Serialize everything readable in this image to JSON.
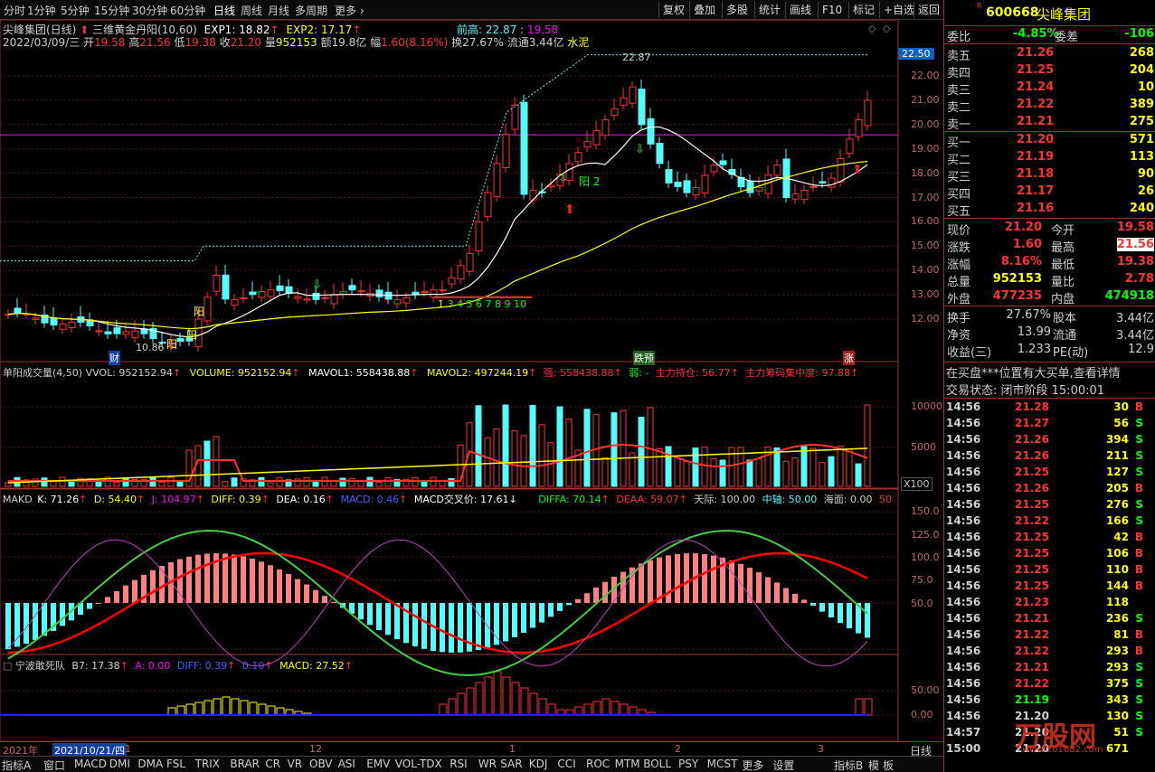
{
  "toolbar": {
    "timeframes": [
      "分时",
      "1分钟",
      "5分钟",
      "15分钟",
      "30分钟",
      "60分钟",
      "日线",
      "周线",
      "月线",
      "多周期",
      "更多"
    ],
    "active": "日线",
    "right_buttons": [
      "复权",
      "叠加",
      "多股",
      "统计",
      "画线",
      "F10",
      "标记",
      "+自选",
      "返回"
    ]
  },
  "main_chart": {
    "stock_title": "尖峰集团(日线)",
    "indicator_name": "三维黄金丹阳(10,60)",
    "exp1": "EXP1: 18.82",
    "exp2": "EXP2: 17.17",
    "prev_high_label": "前高: 22.87",
    "prev_high_value2": "19.58",
    "info_line": {
      "date": "2022/03/09/三",
      "open_label": "开",
      "open": "19.58",
      "high_label": "高",
      "high": "21.56",
      "low_label": "低",
      "low": "19.38",
      "close_label": "收",
      "close": "21.20",
      "vol_label": "量",
      "vol": "952153",
      "amount_label": "额",
      "amount": "19.8亿",
      "range_label": "幅",
      "range": "1.60(8.16%)",
      "turnover": "换27.67%",
      "float": "流通3.44亿",
      "industry": "水泥"
    },
    "price_ticks": [
      "22.00",
      "21.00",
      "20.00",
      "19.00",
      "18.00",
      "17.00",
      "16.00",
      "15.00",
      "14.00",
      "13.00",
      "12.00"
    ],
    "current_price_tag": "22.50",
    "annotations": {
      "high": "22.87",
      "low": "10.86",
      "yang1": "阳",
      "yang2": "阳",
      "yang3": "阳",
      "yang_label": "阳 2",
      "seq": "3 4 5 6 7 8 9 10",
      "cai": "财",
      "diyu": "跌预",
      "zhang": "涨"
    }
  },
  "volume_panel": {
    "title": "单阳成交量(4,50)",
    "vvol": "VVOL: 952152.94",
    "volume": "VOLUME: 952152.94",
    "mavol1": "MAVOL1: 558438.88",
    "mavol2": "MAVOL2: 497244.19",
    "qiang": "强: 558438.88",
    "ruo": "弱: -",
    "zlcc": "主力持仓: 56.77",
    "zlcm": "主力筹码集中度: 97.88",
    "ticks": [
      "10000",
      "5000"
    ],
    "unit": "X100"
  },
  "makd_panel": {
    "title": "MAKD",
    "k": "K: 71.26",
    "d": "D: 54.40",
    "j": "J: 104.97",
    "diff": "DIFF: 0.39",
    "dea": "DEA: 0.16",
    "macd": "MACD: 0.46",
    "cross": "MACD交叉价: 17.61",
    "diffa": "DIFFA: 70.14",
    "deaa": "DEAA: 59.07",
    "tianji": "天际: 100.00",
    "zhongzhou": "中轴: 50.00",
    "haimian": "海面: 0.00",
    "last": "50",
    "ticks": [
      "150.0",
      "125.0",
      "100.0",
      "75.0",
      "50.0"
    ]
  },
  "nb_panel": {
    "title": "宁波敢死队",
    "b7": "B7: 17.38",
    "a": "A: 0.00",
    "diff": "DIFF: 0.39",
    "v": "0.10",
    "macd": "MACD: 27.52",
    "ticks": [
      "50.00",
      "0.00"
    ]
  },
  "x_axis": {
    "year": "2021年",
    "date": "2021/10/21/四",
    "labels": [
      "1",
      "12",
      "1",
      "2",
      "3"
    ],
    "period": "日线"
  },
  "bottom_tabs": [
    "指标A",
    "窗口",
    "MACD",
    "DMI",
    "DMA",
    "FSL",
    "TRIX",
    "BRAR",
    "CR",
    "VR",
    "OBV",
    "ASI",
    "EMV",
    "VOL-TDX",
    "RSI",
    "WR",
    "SAR",
    "KDJ",
    "CCI",
    "ROC",
    "MTM",
    "BOLL",
    "PSY",
    "MCST",
    "更多",
    "设置"
  ],
  "bottom_right": [
    "指标B",
    "模",
    "板"
  ],
  "side": {
    "code": "600668",
    "name": "尖峰集团",
    "weibi_label": "委比",
    "weibi": "-4.85%",
    "weicha_label": "委差",
    "weicha": "-106",
    "asks": [
      {
        "l": "卖五",
        "p": "21.26",
        "v": "268"
      },
      {
        "l": "卖四",
        "p": "21.25",
        "v": "204"
      },
      {
        "l": "卖三",
        "p": "21.24",
        "v": "10"
      },
      {
        "l": "卖二",
        "p": "21.22",
        "v": "389"
      },
      {
        "l": "卖一",
        "p": "21.21",
        "v": "275"
      }
    ],
    "bids": [
      {
        "l": "买一",
        "p": "21.20",
        "v": "571"
      },
      {
        "l": "买二",
        "p": "21.19",
        "v": "113"
      },
      {
        "l": "买三",
        "p": "21.18",
        "v": "90"
      },
      {
        "l": "买四",
        "p": "21.17",
        "v": "26"
      },
      {
        "l": "买五",
        "p": "21.16",
        "v": "240"
      }
    ],
    "quote": [
      {
        "l1": "现价",
        "v1": "21.20",
        "l2": "今开",
        "v2": "19.58"
      },
      {
        "l1": "涨跌",
        "v1": "1.60",
        "l2": "最高",
        "v2": "21.56"
      },
      {
        "l1": "涨幅",
        "v1": "8.16%",
        "l2": "最低",
        "v2": "19.38"
      },
      {
        "l1": "总量",
        "v1": "952153",
        "l2": "量比",
        "v2": "2.78"
      },
      {
        "l1": "外盘",
        "v1": "477235",
        "l2": "内盘",
        "v2": "474918"
      }
    ],
    "stats": [
      {
        "l1": "换手",
        "v1": "27.67%",
        "l2": "股本",
        "v2": "3.44亿"
      },
      {
        "l1": "净资",
        "v1": "13.99",
        "l2": "流通",
        "v2": "3.44亿"
      },
      {
        "l1": "收益(三)",
        "v1": "1.233",
        "l2": "PE(动)",
        "v2": "12.9"
      }
    ],
    "msg": "在买盘***位置有大买单,查看详情",
    "status": "交易状态: 闭市阶段 15:00:01",
    "ticks": [
      {
        "t": "14:56",
        "p": "21.28",
        "v": "30",
        "s": "B"
      },
      {
        "t": "14:56",
        "p": "21.27",
        "v": "56",
        "s": "S"
      },
      {
        "t": "14:56",
        "p": "21.26",
        "v": "394",
        "s": "S"
      },
      {
        "t": "14:56",
        "p": "21.26",
        "v": "211",
        "s": "S"
      },
      {
        "t": "14:56",
        "p": "21.25",
        "v": "127",
        "s": "S"
      },
      {
        "t": "14:56",
        "p": "21.26",
        "v": "205",
        "s": "B"
      },
      {
        "t": "14:56",
        "p": "21.25",
        "v": "276",
        "s": "S"
      },
      {
        "t": "14:56",
        "p": "21.22",
        "v": "166",
        "s": "S"
      },
      {
        "t": "14:56",
        "p": "21.25",
        "v": "42",
        "s": "B"
      },
      {
        "t": "14:56",
        "p": "21.25",
        "v": "106",
        "s": "B"
      },
      {
        "t": "14:56",
        "p": "21.25",
        "v": "110",
        "s": "B"
      },
      {
        "t": "14:56",
        "p": "21.25",
        "v": "144",
        "s": "B"
      },
      {
        "t": "14:56",
        "p": "21.23",
        "v": "118",
        "s": ""
      },
      {
        "t": "14:56",
        "p": "21.21",
        "v": "236",
        "s": "S"
      },
      {
        "t": "14:56",
        "p": "21.22",
        "v": "81",
        "s": "B"
      },
      {
        "t": "14:56",
        "p": "21.22",
        "v": "293",
        "s": "B"
      },
      {
        "t": "14:56",
        "p": "21.21",
        "v": "293",
        "s": "S"
      },
      {
        "t": "14:56",
        "p": "21.22",
        "v": "375",
        "s": "S"
      },
      {
        "t": "14:56",
        "p": "21.19",
        "v": "343",
        "s": "S"
      },
      {
        "t": "14:56",
        "p": "21.20",
        "v": "130",
        "s": "S"
      },
      {
        "t": "14:57",
        "p": "21.20",
        "v": "51",
        "s": "S"
      },
      {
        "t": "15:00",
        "p": "21.20",
        "v": "671",
        "s": ""
      }
    ]
  },
  "watermark": "万股网",
  "watermark_url": "www.201082.com",
  "colors": {
    "up": "#ff3232",
    "down": "#54fcfc",
    "yellow": "#ffff00",
    "white": "#ffffff",
    "green": "#00ff00",
    "magenta": "#ff00ff"
  }
}
